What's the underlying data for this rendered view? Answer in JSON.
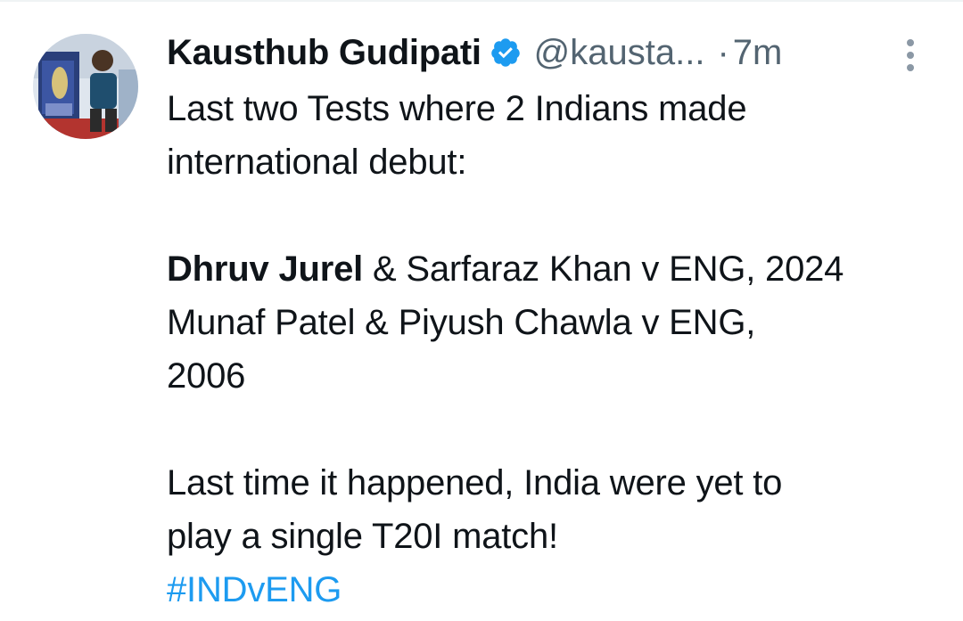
{
  "tweet": {
    "author_name": "Kausthub Gudipati",
    "handle": "@kausta...",
    "separator": "·",
    "timestamp": "7m",
    "verified_icon": "verified-badge-icon",
    "more_icon": "more-vertical-icon",
    "body": {
      "intro_line1": "Last two Tests where 2 Indians made",
      "intro_line2": "international debut:",
      "debut1_bold": "Dhruv Jurel",
      "debut1_rest": " & Sarfaraz Khan v ENG, 2024",
      "debut2_line1": "Munaf Patel & Piyush Chawla v ENG,",
      "debut2_line2": "2006",
      "outro_line1": "Last time it happened, India were yet to",
      "outro_line2": "play a single T20I match!",
      "hashtag": "#INDvENG"
    }
  },
  "colors": {
    "text": "#0f1419",
    "secondary": "#536471",
    "link": "#1d9bf0",
    "verified": "#1d9bf0"
  }
}
